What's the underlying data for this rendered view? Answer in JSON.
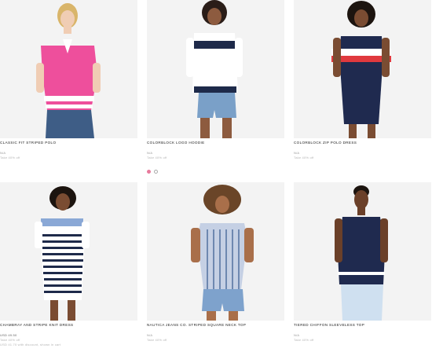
{
  "products": [
    {
      "title": "CLASSIC FIT STRIPED POLO",
      "lines": [
        "N/A",
        "Take 40% off"
      ],
      "colors": {
        "top": "#ee4f9c",
        "stripe": "#ffffff",
        "bottom": "#3e5d86"
      }
    },
    {
      "title": "COLORBLOCK LOGO HOODIE",
      "lines": [
        "N/A",
        "Take 40% off"
      ],
      "colors": {
        "top": "#ffffff",
        "stripe": "#1e2a4a",
        "bottom": "#7aa0c8"
      },
      "swatches": [
        "pink",
        "white"
      ]
    },
    {
      "title": "COLORBLOCK ZIP POLO DRESS",
      "lines": [
        "N/A",
        "Take 40% off"
      ],
      "colors": {
        "top": "#1f2a4f",
        "stripe": "#e0393e",
        "bottom": "#1f2a4f"
      }
    },
    {
      "title": "CHAMBRAY AND STRIPE KNIT DRESS",
      "lines": [
        "USD 49.50",
        "Take 40% off",
        "USD 41.70 with discount, shown in cart"
      ],
      "colors": {
        "top": "#8aa8d6",
        "stripe": "#1e2a4a",
        "bottom": "#ffffff"
      }
    },
    {
      "title": "NAUTICA JEANS CO. STRIPED SQUARE NECK TOP",
      "lines": [
        "N/A",
        "Take 40% off"
      ],
      "colors": {
        "top": "#c5d0e4",
        "stripe": "#6e88b0",
        "bottom": "#7ea2cc"
      }
    },
    {
      "title": "TIERED CHIFFON SLEEVELESS TOP",
      "lines": [
        "N/A",
        "Take 40% off"
      ],
      "colors": {
        "top": "#1f2a4f",
        "stripe": "#ffffff",
        "bottom": "#cfe0f0"
      }
    }
  ]
}
